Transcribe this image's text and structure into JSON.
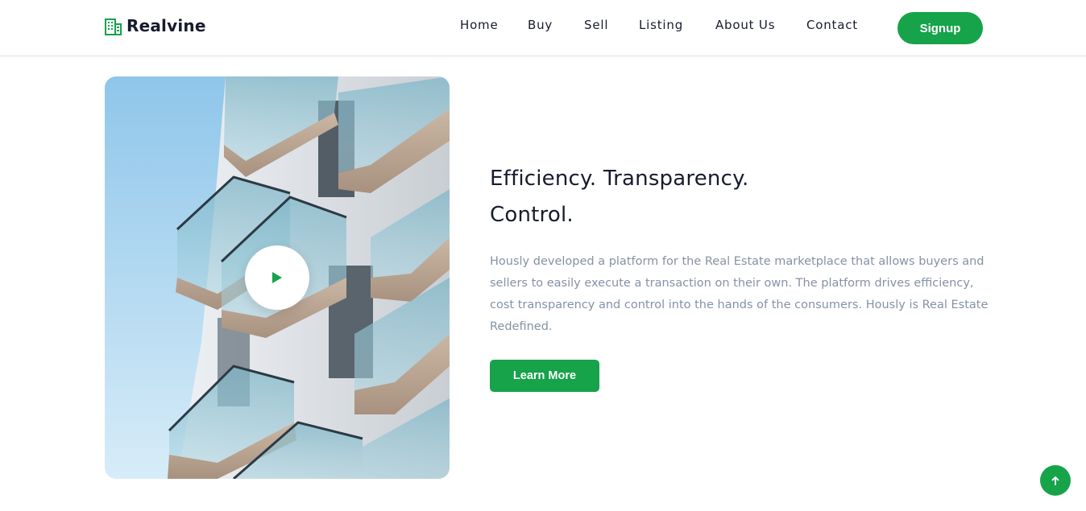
{
  "brand": {
    "name": "Realvine",
    "logo_icon": "building-icon",
    "accent_color": "#16a34a"
  },
  "nav": {
    "items": [
      {
        "label": "Home"
      },
      {
        "label": "Buy"
      },
      {
        "label": "Sell"
      },
      {
        "label": "Listing"
      },
      {
        "label": "About Us"
      },
      {
        "label": "Contact"
      }
    ],
    "signup_label": "Signup"
  },
  "hero": {
    "image_subject": "apartment-building-photo",
    "play_icon": "play-icon",
    "headline_line1": "Efficiency. Transparency.",
    "headline_line2": "Control.",
    "description": "Hously developed a platform for the Real Estate marketplace that allows buyers and sellers to easily execute a transaction on their own. The platform drives efficiency, cost transparency and control into the hands of the consumers. Hously is Real Estate Redefined.",
    "cta_label": "Learn More"
  },
  "back_to_top_icon": "arrow-up-icon"
}
